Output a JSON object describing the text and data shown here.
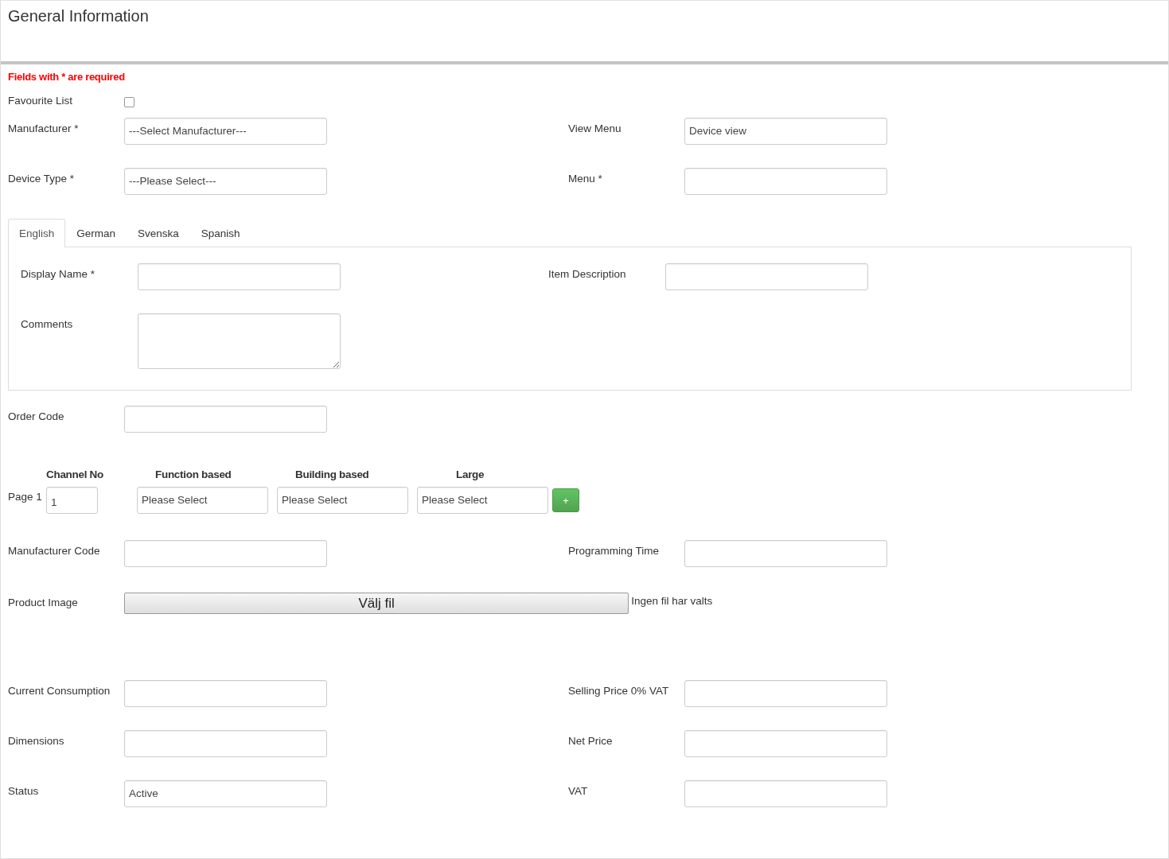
{
  "title": "General Information",
  "required_note": "Fields with * are required",
  "favourite": {
    "label": "Favourite List",
    "checked": false
  },
  "top_rows": [
    {
      "left": {
        "label": "Manufacturer *",
        "kind": "select",
        "value": "---Select Manufacturer---"
      },
      "right": {
        "label": "View Menu",
        "kind": "select",
        "value": "Device view"
      }
    },
    {
      "left": {
        "label": "Device Type *",
        "kind": "select",
        "value": "---Please Select---"
      },
      "right": {
        "label": "Menu *",
        "kind": "select"
      }
    }
  ],
  "tabs": [
    {
      "label": "English",
      "selected": true
    },
    {
      "label": "German",
      "selected": false
    },
    {
      "label": "Svenska",
      "selected": false
    },
    {
      "label": "Spanish",
      "selected": false
    }
  ],
  "tab_panel": [
    {
      "left": {
        "label": "Display Name *",
        "kind": "text"
      },
      "right": {
        "label": "Item Description",
        "kind": "text"
      }
    },
    {
      "left": {
        "label": "Comments",
        "kind": "textarea"
      }
    }
  ],
  "order_code": {
    "label": "Order Code",
    "kind": "text"
  },
  "channels": {
    "headers": [
      "Channel No",
      "Function based",
      "Building based",
      "Large"
    ],
    "rows": [
      {
        "label": "Page 1",
        "channel_no": "1",
        "selects": [
          "Please Select",
          "Please Select",
          "Please Select"
        ],
        "add_button": "+"
      }
    ]
  },
  "mid_rows": [
    {
      "left": {
        "label": "Manufacturer Code",
        "kind": "text"
      },
      "right": {
        "label": "Programming Time",
        "kind": "text"
      }
    }
  ],
  "product_image": {
    "label": "Product Image",
    "button": "Välj fil",
    "status": "Ingen fil har valts"
  },
  "bottom_rows": [
    {
      "left": {
        "label": "Current Consumption",
        "kind": "text"
      },
      "right": {
        "label": "Selling Price 0% VAT",
        "kind": "text"
      }
    },
    {
      "left": {
        "label": "Dimensions",
        "kind": "text"
      },
      "right": {
        "label": "Net Price",
        "kind": "text"
      }
    },
    {
      "left": {
        "label": "Status",
        "kind": "select",
        "value": "Active"
      },
      "right": {
        "label": "VAT",
        "kind": "text"
      }
    }
  ]
}
